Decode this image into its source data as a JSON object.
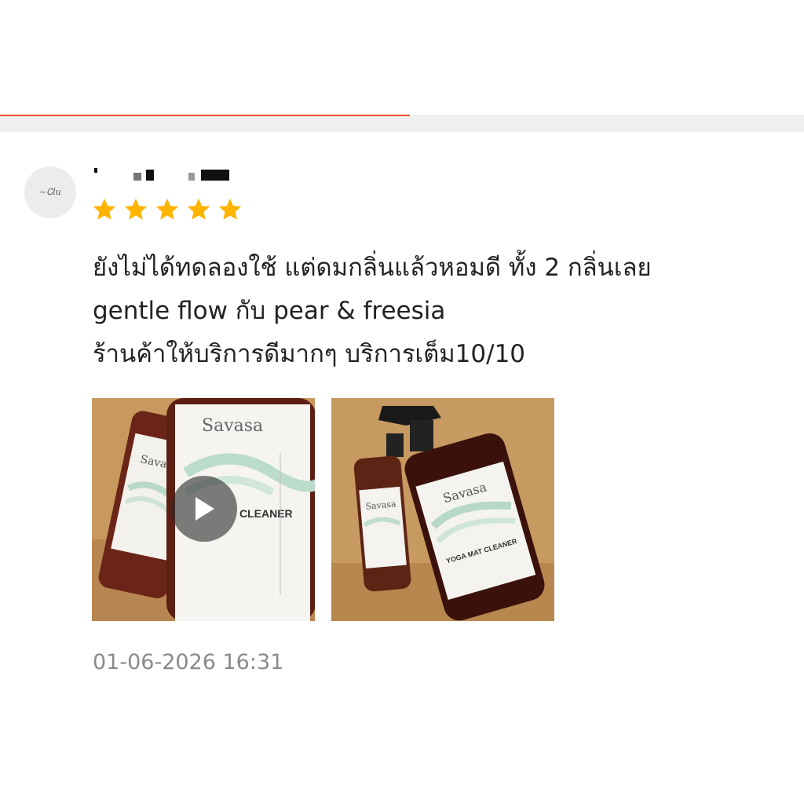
{
  "progress": {
    "fraction": 0.51,
    "color": "#ee4d2d"
  },
  "review": {
    "avatar_icon": "user-avatar",
    "rating": 5,
    "star_color": "#ffb400",
    "lines": [
      "ยังไม่ได้ทดลองใช้ แต่ดมกลิ่นแล้วหอมดี ทั้ง 2 กลิ่นเลย",
      "gentle flow กับ pear & freesia",
      "ร้านค้าให้บริการดีมากๆ  บริการเต็ม10/10"
    ],
    "media": [
      {
        "type": "video",
        "brand": "Savasa",
        "product": "CLEANER",
        "icon": "play-icon"
      },
      {
        "type": "image",
        "brand": "Savasa",
        "product": "YOGA MAT CLEANER"
      }
    ],
    "timestamp": "01-06-2026 16:31"
  }
}
